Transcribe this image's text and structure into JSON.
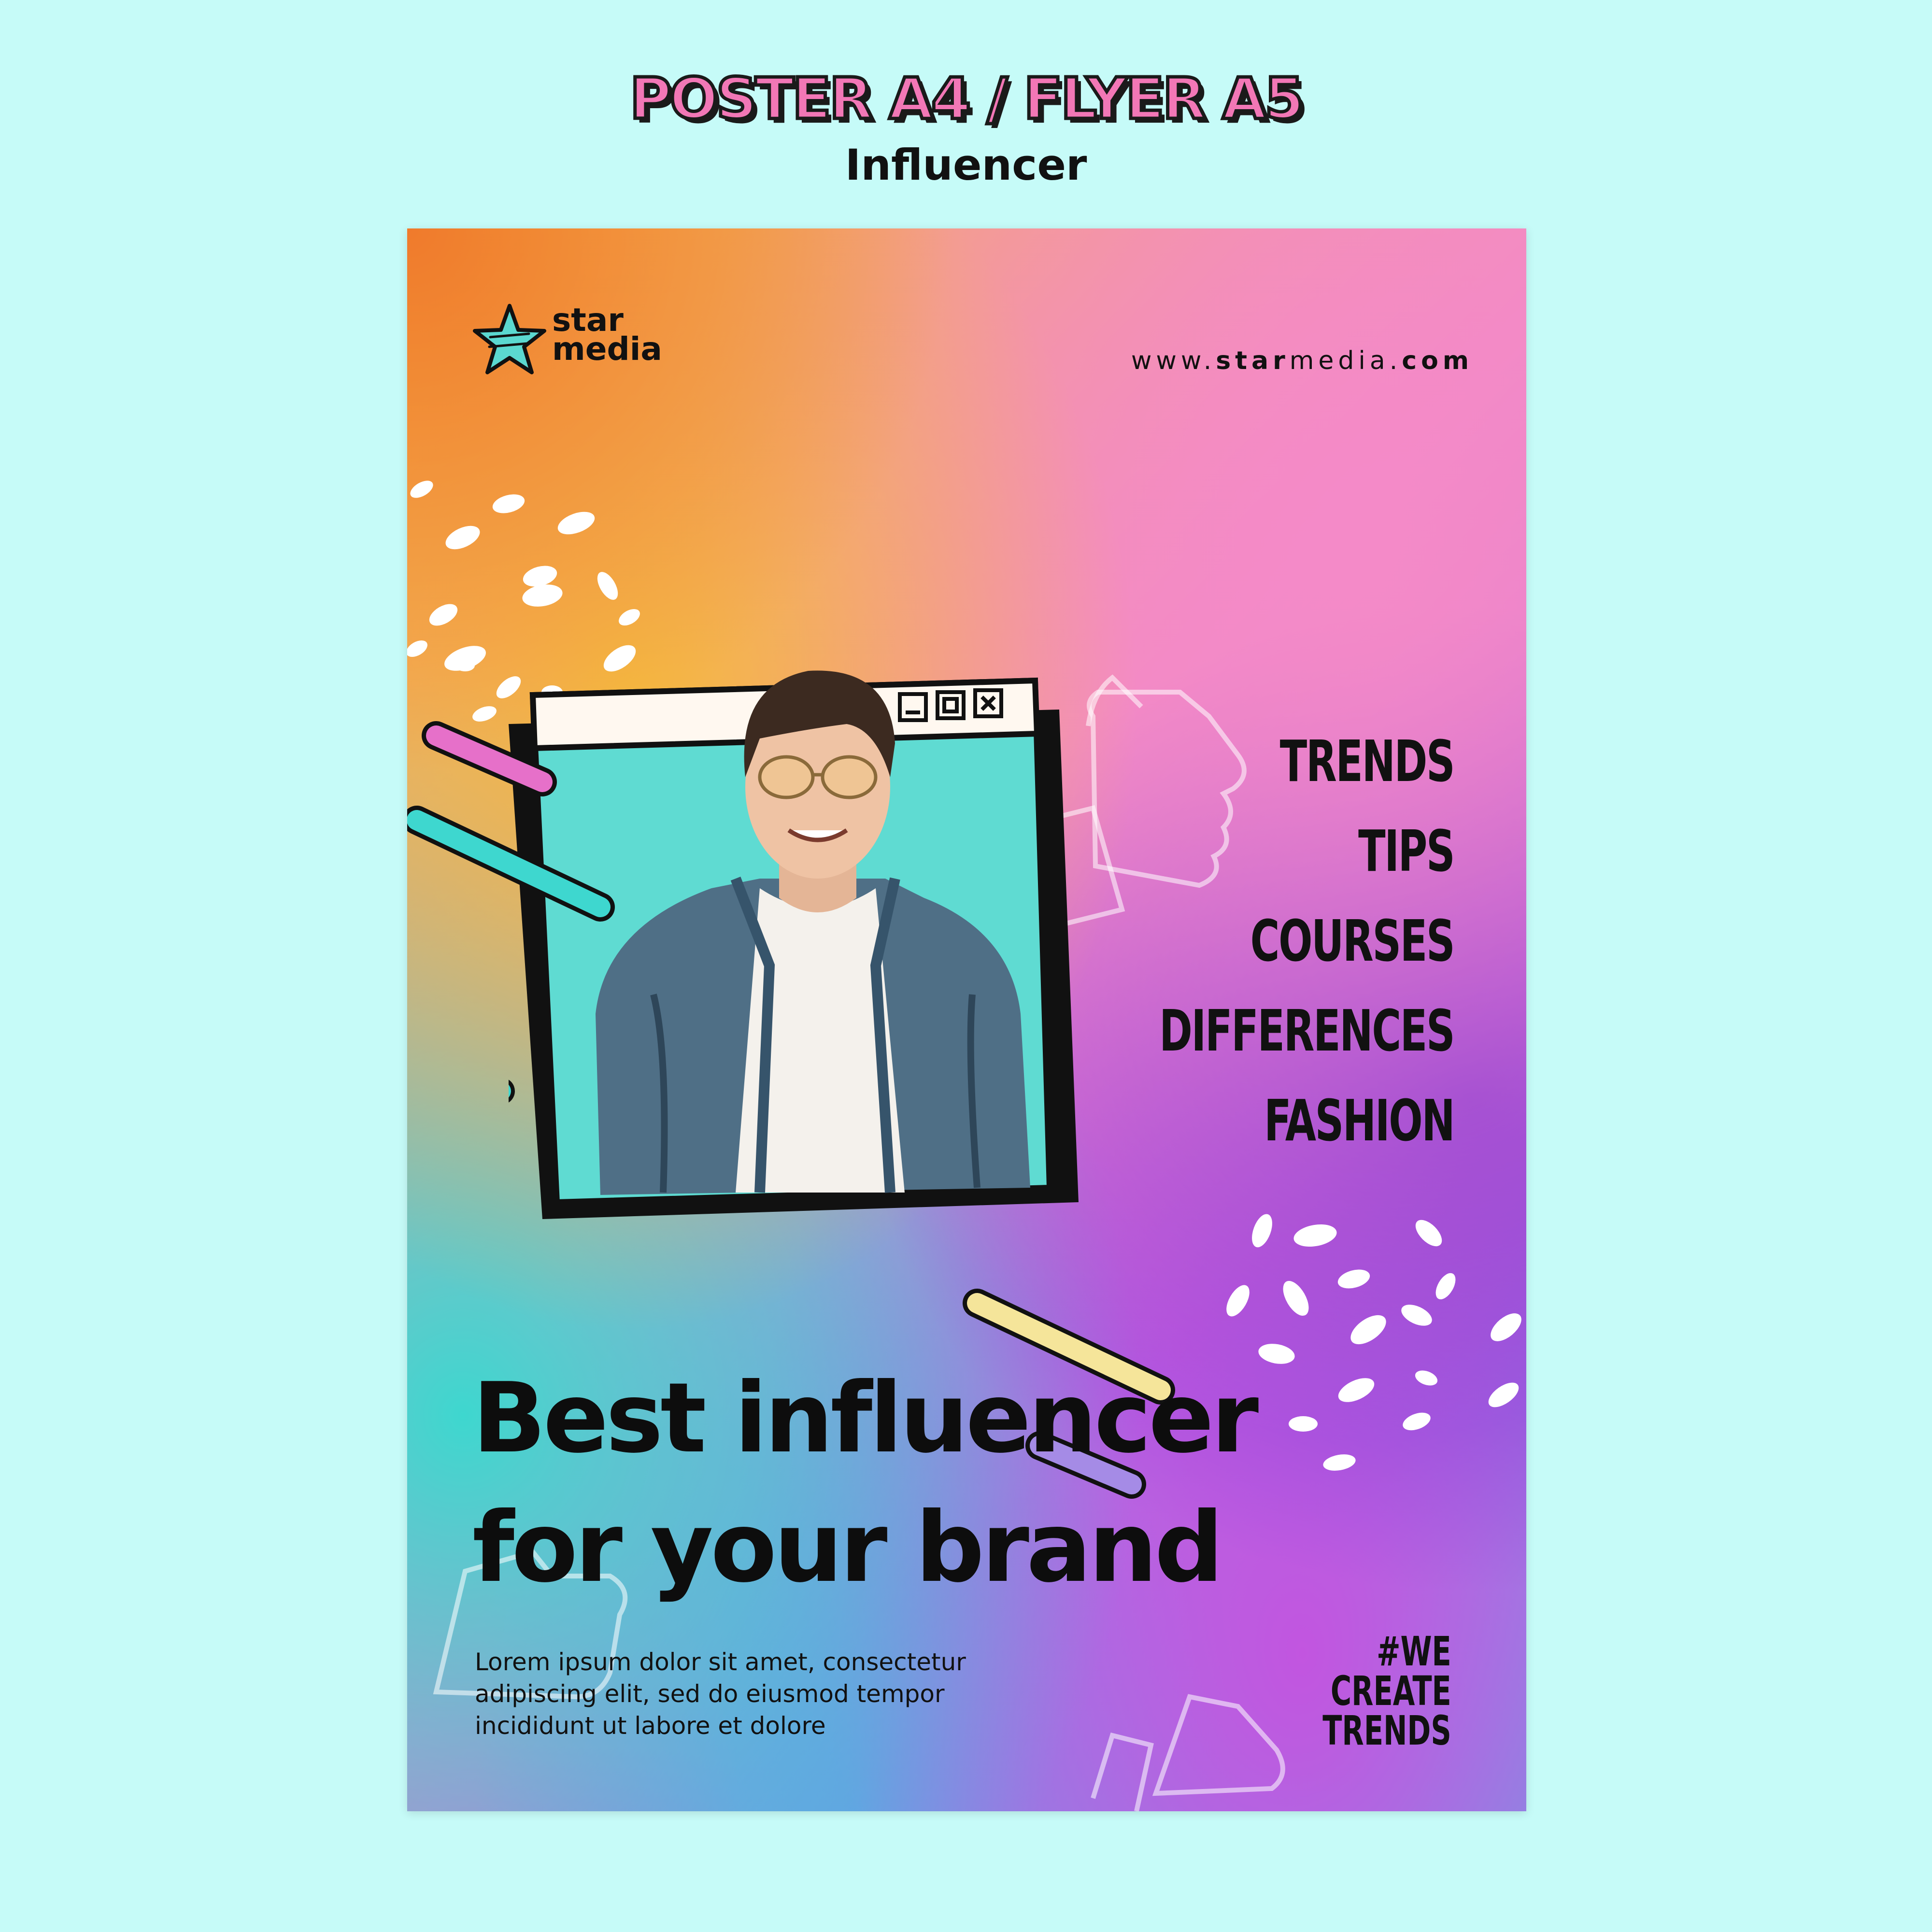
{
  "header": {
    "title": "POSTER A4 / FLYER A5",
    "subtitle": "Influencer"
  },
  "poster": {
    "logo": {
      "line1": "star",
      "line2": "media",
      "icon": "star-icon"
    },
    "website": {
      "prefix": "www.",
      "brand": "star",
      "middle": "media.",
      "suffix": "com"
    },
    "window_controls": [
      "minimize",
      "maximize",
      "close"
    ],
    "topics": [
      "TRENDS",
      "TIPS",
      "COURSES",
      "DIFFERENCES",
      "FASHION"
    ],
    "headline": {
      "line1": "Best influencer",
      "line2": "for your brand"
    },
    "body": {
      "line1": "Lorem ipsum dolor sit amet, consectetur",
      "line2": "adipiscing elit, sed do eiusmod tempor",
      "line3": "incididunt ut labore et dolore"
    },
    "hashtag": {
      "line1": "#WE",
      "line2": "CREATE",
      "line3": "TRENDS"
    },
    "colors": {
      "page_background": "#c6fbf8",
      "title_pink": "#f277b6",
      "teal": "#3ed7cf",
      "pink": "#e670c9",
      "yellow": "#f5e59a",
      "violet": "#a58be6",
      "ink": "#111111"
    }
  }
}
